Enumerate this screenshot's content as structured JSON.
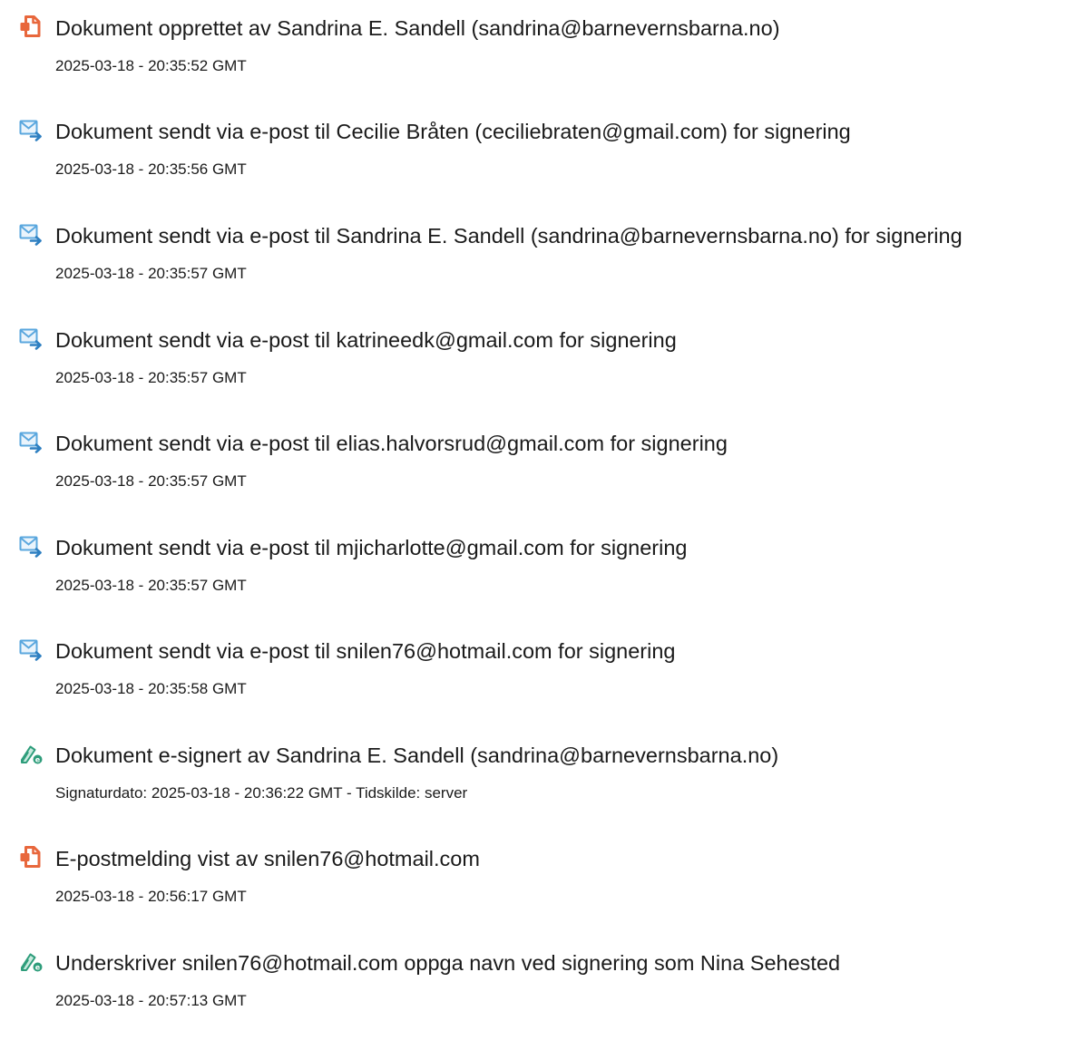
{
  "log": {
    "entries": [
      {
        "icon": "document-created-icon",
        "title": "Dokument opprettet av Sandrina E. Sandell (sandrina@barnevernsbarna.no)",
        "meta": "2025-03-18 - 20:35:52 GMT"
      },
      {
        "icon": "email-sent-icon",
        "title": "Dokument sendt via e-post til Cecilie Bråten (ceciliebraten@gmail.com) for signering",
        "meta": "2025-03-18 - 20:35:56 GMT"
      },
      {
        "icon": "email-sent-icon",
        "title": "Dokument sendt via e-post til Sandrina E. Sandell (sandrina@barnevernsbarna.no) for signering",
        "meta": "2025-03-18 - 20:35:57 GMT"
      },
      {
        "icon": "email-sent-icon",
        "title": "Dokument sendt via e-post til katrineedk@gmail.com for signering",
        "meta": "2025-03-18 - 20:35:57 GMT"
      },
      {
        "icon": "email-sent-icon",
        "title": "Dokument sendt via e-post til elias.halvorsrud@gmail.com for signering",
        "meta": "2025-03-18 - 20:35:57 GMT"
      },
      {
        "icon": "email-sent-icon",
        "title": "Dokument sendt via e-post til mjicharlotte@gmail.com for signering",
        "meta": "2025-03-18 - 20:35:57 GMT"
      },
      {
        "icon": "email-sent-icon",
        "title": "Dokument sendt via e-post til snilen76@hotmail.com for signering",
        "meta": "2025-03-18 - 20:35:58 GMT"
      },
      {
        "icon": "e-signed-icon",
        "title": "Dokument e-signert av Sandrina E. Sandell (sandrina@barnevernsbarna.no)",
        "meta": "Signaturdato: 2025-03-18 - 20:36:22 GMT - Tidskilde: server"
      },
      {
        "icon": "email-viewed-icon",
        "title": "E-postmelding vist av snilen76@hotmail.com",
        "meta": "2025-03-18 - 20:56:17 GMT"
      },
      {
        "icon": "signer-name-icon",
        "title": "Underskriver snilen76@hotmail.com oppga navn ved signering som Nina Sehested",
        "meta": "2025-03-18 - 20:57:13 GMT"
      }
    ]
  },
  "colors": {
    "document_icon": "#E8673C",
    "mail_icon": "#5AA7DE",
    "sign_icon": "#2E9D7B"
  }
}
